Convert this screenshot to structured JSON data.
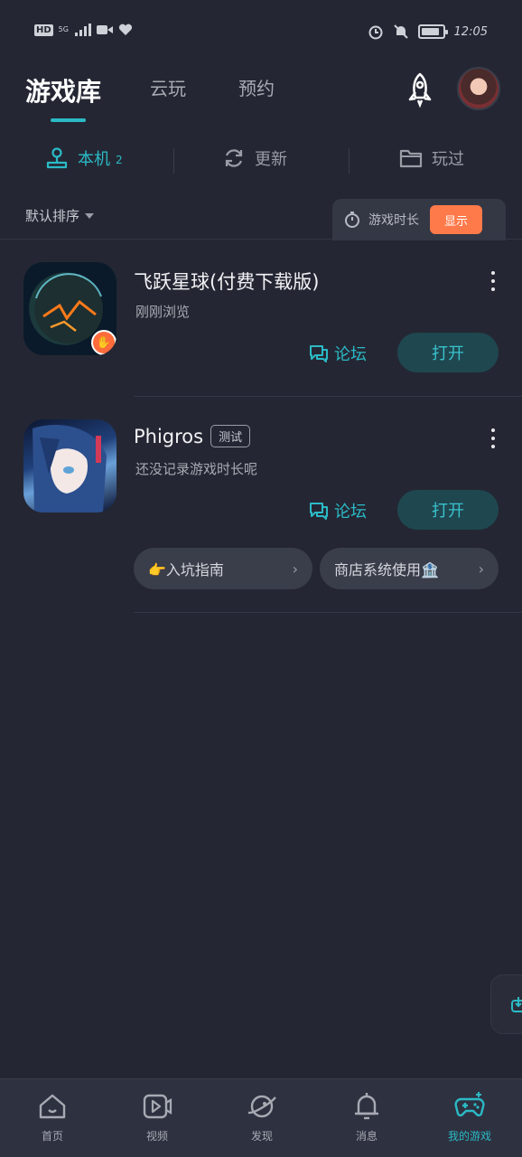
{
  "status_bar": {
    "left_icons": [
      "hd-icon",
      "5g-signal-icon",
      "video-icon",
      "heart-icon"
    ],
    "hd": "HD",
    "network": "5G",
    "right_icons": [
      "alarm-icon",
      "mute-bell-icon",
      "battery-icon"
    ],
    "battery_level": 0.85,
    "time": "12:05"
  },
  "header": {
    "tabs": [
      {
        "label": "游戏库",
        "active": true
      },
      {
        "label": "云玩",
        "active": false
      },
      {
        "label": "预约",
        "active": false
      }
    ],
    "accent_color": "#2bbac6"
  },
  "subtabs": [
    {
      "label": "本机",
      "count": "2",
      "active": true,
      "icon": "joystick-icon"
    },
    {
      "label": "更新",
      "count": "",
      "active": false,
      "icon": "refresh-icon"
    },
    {
      "label": "玩过",
      "count": "",
      "active": false,
      "icon": "folder-icon"
    }
  ],
  "sort": {
    "label": "默认排序",
    "playtime_label": "游戏时长",
    "show_button": "显示"
  },
  "games": [
    {
      "title": "飞跃星球(付费下载版)",
      "tag": "",
      "subtitle": "刚刚浏览",
      "forum_label": "论坛",
      "open_label": "打开",
      "chips": []
    },
    {
      "title": "Phigros",
      "tag": "测试",
      "subtitle": "还没记录游戏时长呢",
      "forum_label": "论坛",
      "open_label": "打开",
      "chips": [
        {
          "label": "👉入坑指南"
        },
        {
          "label": "商店系统使用🏦"
        }
      ]
    }
  ],
  "bottom_nav": [
    {
      "label": "首页",
      "icon": "home-icon",
      "active": false
    },
    {
      "label": "视频",
      "icon": "video-play-icon",
      "active": false
    },
    {
      "label": "发现",
      "icon": "planet-icon",
      "active": false
    },
    {
      "label": "消息",
      "icon": "bell-icon",
      "active": false
    },
    {
      "label": "我的游戏",
      "icon": "gamepad-icon",
      "active": true
    }
  ]
}
